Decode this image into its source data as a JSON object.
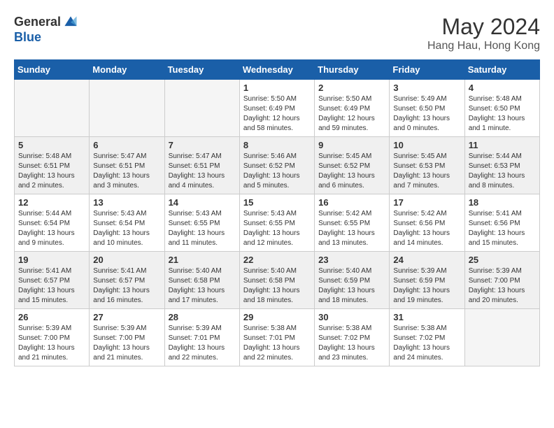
{
  "logo": {
    "general": "General",
    "blue": "Blue"
  },
  "title": "May 2024",
  "location": "Hang Hau, Hong Kong",
  "days_header": [
    "Sunday",
    "Monday",
    "Tuesday",
    "Wednesday",
    "Thursday",
    "Friday",
    "Saturday"
  ],
  "weeks": [
    [
      {
        "num": "",
        "info": "",
        "empty": true
      },
      {
        "num": "",
        "info": "",
        "empty": true
      },
      {
        "num": "",
        "info": "",
        "empty": true
      },
      {
        "num": "1",
        "info": "Sunrise: 5:50 AM\nSunset: 6:49 PM\nDaylight: 12 hours\nand 58 minutes."
      },
      {
        "num": "2",
        "info": "Sunrise: 5:50 AM\nSunset: 6:49 PM\nDaylight: 12 hours\nand 59 minutes."
      },
      {
        "num": "3",
        "info": "Sunrise: 5:49 AM\nSunset: 6:50 PM\nDaylight: 13 hours\nand 0 minutes."
      },
      {
        "num": "4",
        "info": "Sunrise: 5:48 AM\nSunset: 6:50 PM\nDaylight: 13 hours\nand 1 minute."
      }
    ],
    [
      {
        "num": "5",
        "info": "Sunrise: 5:48 AM\nSunset: 6:51 PM\nDaylight: 13 hours\nand 2 minutes.",
        "shaded": true
      },
      {
        "num": "6",
        "info": "Sunrise: 5:47 AM\nSunset: 6:51 PM\nDaylight: 13 hours\nand 3 minutes.",
        "shaded": true
      },
      {
        "num": "7",
        "info": "Sunrise: 5:47 AM\nSunset: 6:51 PM\nDaylight: 13 hours\nand 4 minutes.",
        "shaded": true
      },
      {
        "num": "8",
        "info": "Sunrise: 5:46 AM\nSunset: 6:52 PM\nDaylight: 13 hours\nand 5 minutes.",
        "shaded": true
      },
      {
        "num": "9",
        "info": "Sunrise: 5:45 AM\nSunset: 6:52 PM\nDaylight: 13 hours\nand 6 minutes.",
        "shaded": true
      },
      {
        "num": "10",
        "info": "Sunrise: 5:45 AM\nSunset: 6:53 PM\nDaylight: 13 hours\nand 7 minutes.",
        "shaded": true
      },
      {
        "num": "11",
        "info": "Sunrise: 5:44 AM\nSunset: 6:53 PM\nDaylight: 13 hours\nand 8 minutes.",
        "shaded": true
      }
    ],
    [
      {
        "num": "12",
        "info": "Sunrise: 5:44 AM\nSunset: 6:54 PM\nDaylight: 13 hours\nand 9 minutes."
      },
      {
        "num": "13",
        "info": "Sunrise: 5:43 AM\nSunset: 6:54 PM\nDaylight: 13 hours\nand 10 minutes."
      },
      {
        "num": "14",
        "info": "Sunrise: 5:43 AM\nSunset: 6:55 PM\nDaylight: 13 hours\nand 11 minutes."
      },
      {
        "num": "15",
        "info": "Sunrise: 5:43 AM\nSunset: 6:55 PM\nDaylight: 13 hours\nand 12 minutes."
      },
      {
        "num": "16",
        "info": "Sunrise: 5:42 AM\nSunset: 6:55 PM\nDaylight: 13 hours\nand 13 minutes."
      },
      {
        "num": "17",
        "info": "Sunrise: 5:42 AM\nSunset: 6:56 PM\nDaylight: 13 hours\nand 14 minutes."
      },
      {
        "num": "18",
        "info": "Sunrise: 5:41 AM\nSunset: 6:56 PM\nDaylight: 13 hours\nand 15 minutes."
      }
    ],
    [
      {
        "num": "19",
        "info": "Sunrise: 5:41 AM\nSunset: 6:57 PM\nDaylight: 13 hours\nand 15 minutes.",
        "shaded": true
      },
      {
        "num": "20",
        "info": "Sunrise: 5:41 AM\nSunset: 6:57 PM\nDaylight: 13 hours\nand 16 minutes.",
        "shaded": true
      },
      {
        "num": "21",
        "info": "Sunrise: 5:40 AM\nSunset: 6:58 PM\nDaylight: 13 hours\nand 17 minutes.",
        "shaded": true
      },
      {
        "num": "22",
        "info": "Sunrise: 5:40 AM\nSunset: 6:58 PM\nDaylight: 13 hours\nand 18 minutes.",
        "shaded": true
      },
      {
        "num": "23",
        "info": "Sunrise: 5:40 AM\nSunset: 6:59 PM\nDaylight: 13 hours\nand 18 minutes.",
        "shaded": true
      },
      {
        "num": "24",
        "info": "Sunrise: 5:39 AM\nSunset: 6:59 PM\nDaylight: 13 hours\nand 19 minutes.",
        "shaded": true
      },
      {
        "num": "25",
        "info": "Sunrise: 5:39 AM\nSunset: 7:00 PM\nDaylight: 13 hours\nand 20 minutes.",
        "shaded": true
      }
    ],
    [
      {
        "num": "26",
        "info": "Sunrise: 5:39 AM\nSunset: 7:00 PM\nDaylight: 13 hours\nand 21 minutes."
      },
      {
        "num": "27",
        "info": "Sunrise: 5:39 AM\nSunset: 7:00 PM\nDaylight: 13 hours\nand 21 minutes."
      },
      {
        "num": "28",
        "info": "Sunrise: 5:39 AM\nSunset: 7:01 PM\nDaylight: 13 hours\nand 22 minutes."
      },
      {
        "num": "29",
        "info": "Sunrise: 5:38 AM\nSunset: 7:01 PM\nDaylight: 13 hours\nand 22 minutes."
      },
      {
        "num": "30",
        "info": "Sunrise: 5:38 AM\nSunset: 7:02 PM\nDaylight: 13 hours\nand 23 minutes."
      },
      {
        "num": "31",
        "info": "Sunrise: 5:38 AM\nSunset: 7:02 PM\nDaylight: 13 hours\nand 24 minutes."
      },
      {
        "num": "",
        "info": "",
        "empty": true
      }
    ]
  ]
}
